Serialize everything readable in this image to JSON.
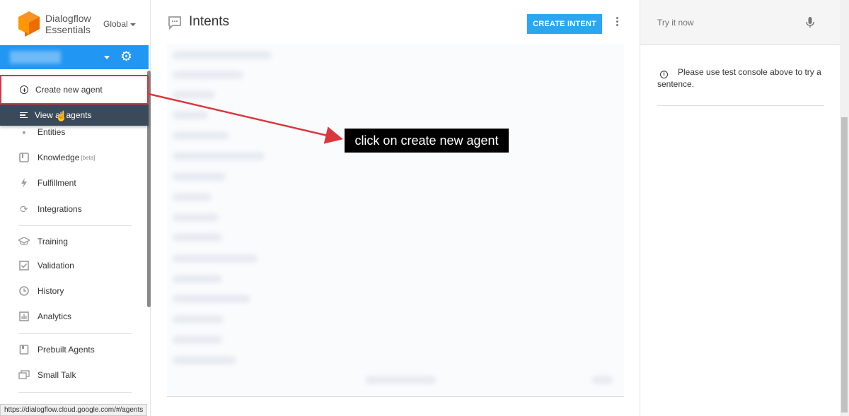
{
  "brand": {
    "line1": "Dialogflow",
    "line2": "Essentials",
    "region": "Global"
  },
  "agent_menu": {
    "create_label": "Create new agent",
    "view_all_label": "View all agents"
  },
  "sidebar": {
    "items": [
      {
        "label": "Entities",
        "icon": "entities-icon"
      },
      {
        "label": "Knowledge",
        "sup": "[beta]",
        "icon": "knowledge-icon"
      },
      {
        "label": "Fulfillment",
        "icon": "fulfillment-icon"
      },
      {
        "label": "Integrations",
        "icon": "integrations-icon"
      },
      {
        "label": "Training",
        "icon": "training-icon"
      },
      {
        "label": "Validation",
        "icon": "validation-icon"
      },
      {
        "label": "History",
        "icon": "history-icon"
      },
      {
        "label": "Analytics",
        "icon": "analytics-icon"
      },
      {
        "label": "Prebuilt Agents",
        "icon": "prebuilt-agents-icon"
      },
      {
        "label": "Small Talk",
        "icon": "small-talk-icon"
      }
    ]
  },
  "status_url": "https://dialogflow.cloud.google.com/#/agents",
  "main": {
    "title": "Intents",
    "create_button": "CREATE INTENT"
  },
  "annotation": {
    "tooltip": "click on create new agent"
  },
  "console": {
    "placeholder": "Try it now",
    "info": "Please use test console above to try a sentence."
  },
  "colors": {
    "accent": "#2196f3",
    "button": "#2aa7f0",
    "highlight_border": "#d9363e",
    "menu_dark": "#3b4a5a"
  }
}
